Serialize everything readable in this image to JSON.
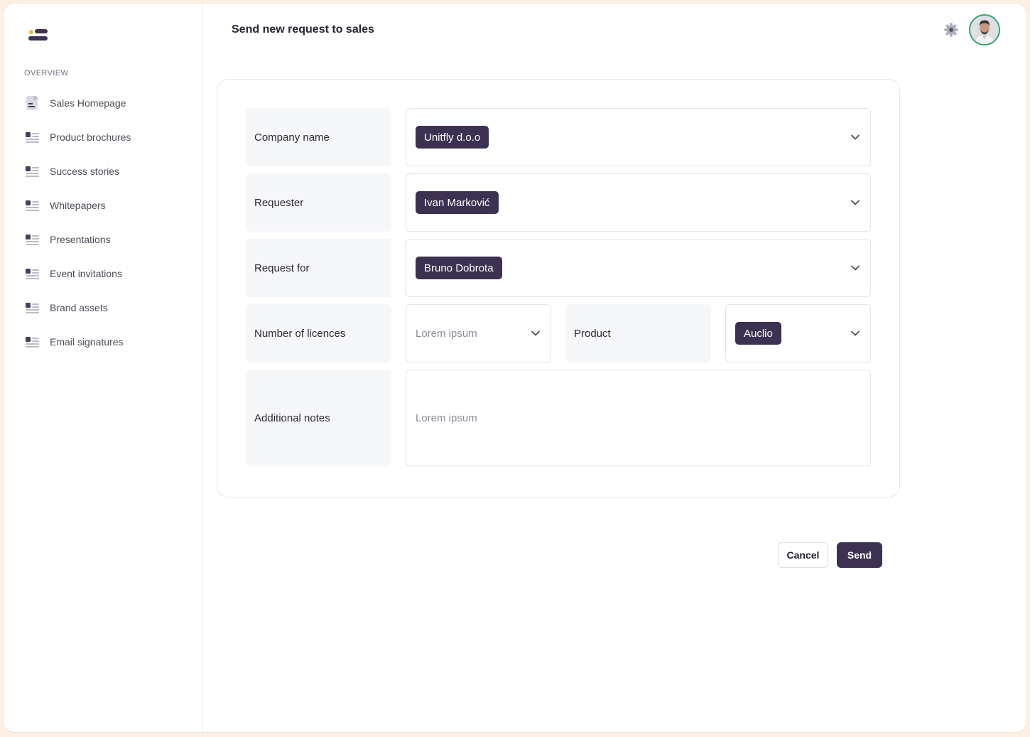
{
  "header": {
    "title": "Send new request to sales",
    "settings_icon": "gear-icon",
    "avatar_icon": "user-avatar"
  },
  "sidebar": {
    "section_label": "OVERVIEW",
    "items": [
      {
        "label": "Sales Homepage",
        "icon": "document-icon"
      },
      {
        "label": "Product brochures",
        "icon": "list-icon"
      },
      {
        "label": "Success stories",
        "icon": "list-icon"
      },
      {
        "label": "Whitepapers",
        "icon": "list-icon"
      },
      {
        "label": "Presentations",
        "icon": "list-icon"
      },
      {
        "label": "Event invitations",
        "icon": "list-icon"
      },
      {
        "label": "Brand assets",
        "icon": "list-icon"
      },
      {
        "label": "Email signatures",
        "icon": "list-icon"
      }
    ]
  },
  "form": {
    "company": {
      "label": "Company name",
      "value": "Unitfly d.o.o"
    },
    "requester": {
      "label": "Requester",
      "value": "Ivan Marković"
    },
    "request_for": {
      "label": "Request for",
      "value": "Bruno Dobrota"
    },
    "licences": {
      "label": "Number of licences",
      "placeholder": "Lorem ipsum"
    },
    "product": {
      "label": "Product",
      "value": "Auclio"
    },
    "notes": {
      "label": "Additional notes",
      "placeholder": "Lorem ipsum"
    }
  },
  "actions": {
    "cancel_label": "Cancel",
    "send_label": "Send"
  },
  "colors": {
    "accent": "#3d3152",
    "logo_dot": "#f2b53d",
    "avatar_ring": "#37a26b",
    "frame_border": "#fdf1e6"
  }
}
